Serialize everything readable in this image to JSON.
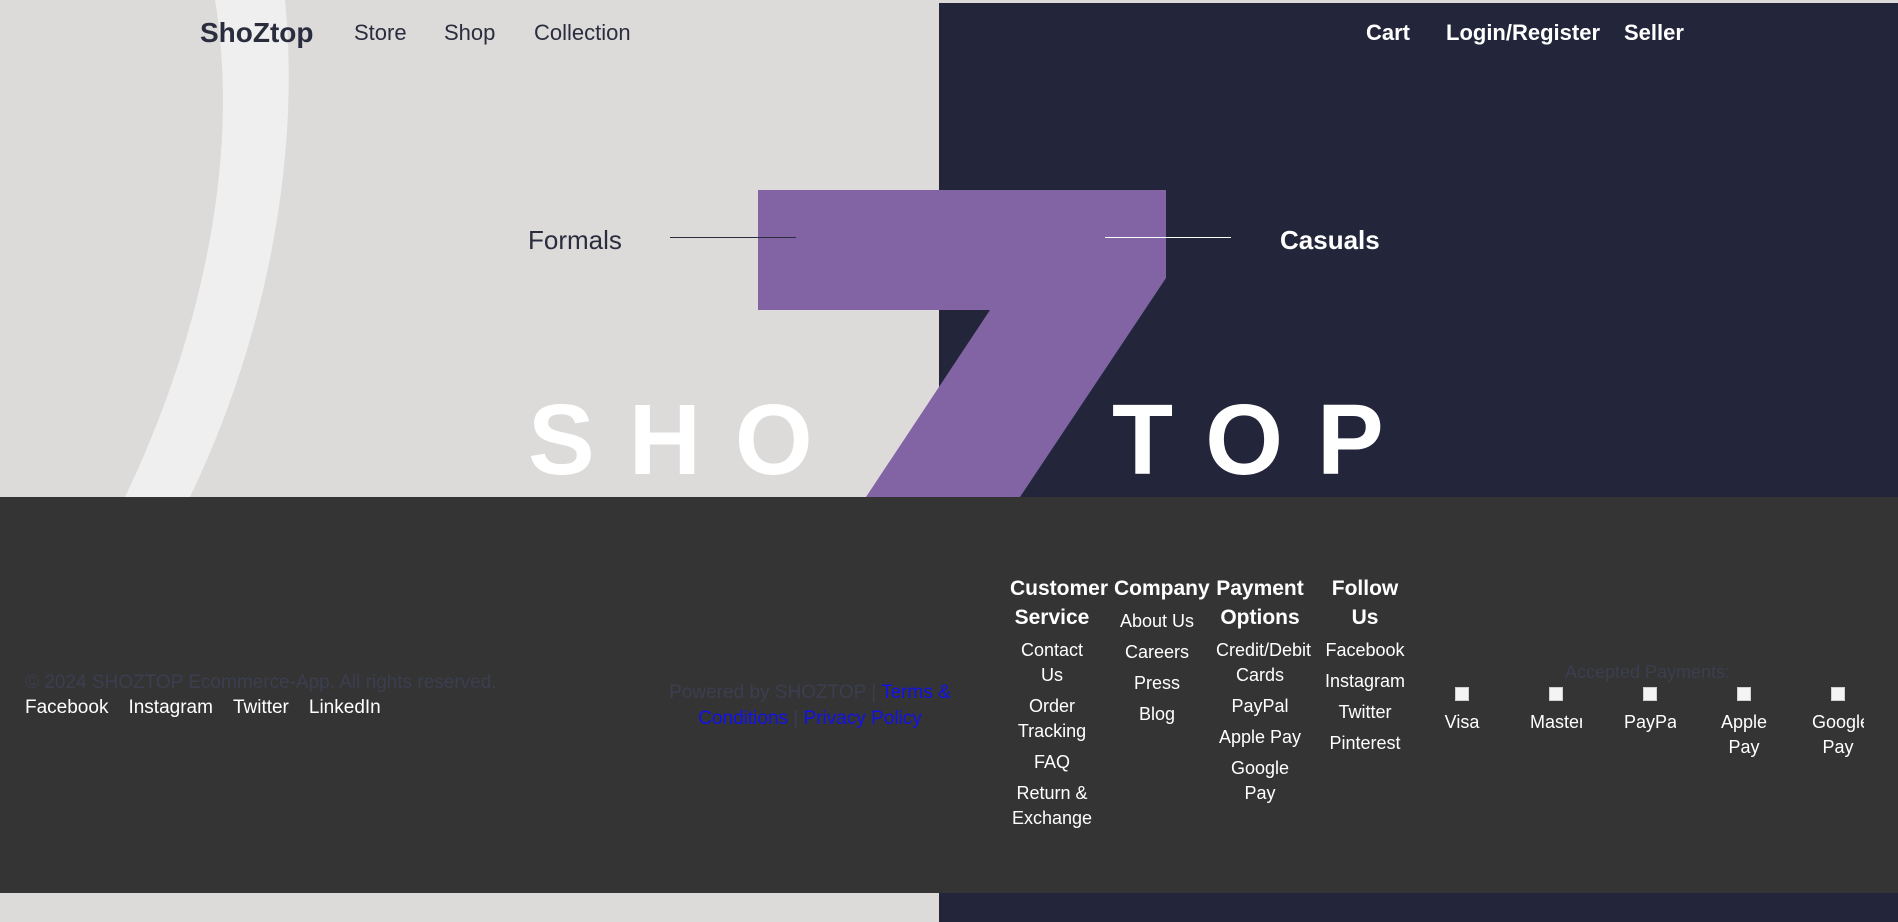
{
  "brand": "ShoZtop",
  "nav": {
    "left": [
      "Store",
      "Shop",
      "Collection"
    ],
    "right": [
      "Cart",
      "Login/Register",
      "Seller"
    ]
  },
  "hero": {
    "left_label": "Formals",
    "right_label": "Casuals",
    "word_left": "SHO",
    "word_right": "TOP",
    "accent_color": "#8264a4",
    "left_bg": "#dcdbda",
    "right_bg": "#23263a"
  },
  "footer": {
    "copyright": "© 2024 SHOZTOP Ecommerce-App. All rights reserved.",
    "social": [
      "Facebook",
      "Instagram",
      "Twitter",
      "LinkedIn"
    ],
    "powered_by": "Powered by SHOZTOP |",
    "terms": "Terms & Conditions",
    "separator": "|",
    "privacy": "Privacy Policy",
    "columns": [
      {
        "title": "Customer Service",
        "items": [
          "Contact Us",
          "Order Tracking",
          "FAQ",
          "Return & Exchange"
        ]
      },
      {
        "title": "Company",
        "items": [
          "About Us",
          "Careers",
          "Press",
          "Blog"
        ]
      },
      {
        "title": "Payment Options",
        "items": [
          "Credit/Debit Cards",
          "PayPal",
          "Apple Pay",
          "Google Pay"
        ]
      },
      {
        "title": "Follow Us",
        "items": [
          "Facebook",
          "Instagram",
          "Twitter",
          "Pinterest"
        ]
      }
    ],
    "accepted_title": "Accepted Payments:",
    "payment_alts": [
      "Visa",
      "Master",
      "PayPal",
      "Apple Pay",
      "Google Pay"
    ],
    "bg_color": "#343434"
  }
}
